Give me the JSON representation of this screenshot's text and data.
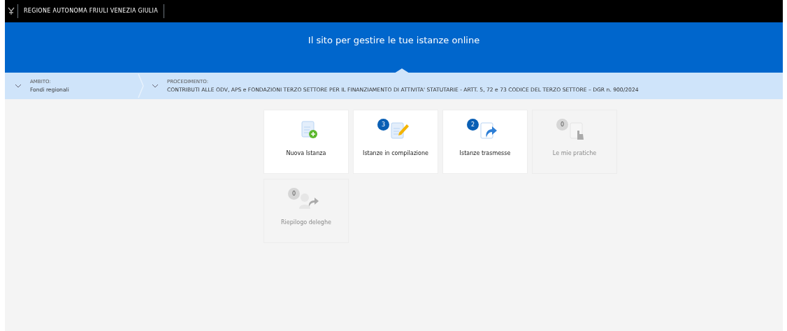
{
  "header": {
    "region_name": "REGIONE AUTONOMA FRIULI VENEZIA GIULIA"
  },
  "hero": {
    "title": "Il sito per gestire le tue istanze online"
  },
  "selectors": [
    {
      "label": "AMBITO:",
      "value": "Fondi regionali"
    },
    {
      "label": "PROCEDIMENTO:",
      "value": "CONTRIBUTI ALLE ODV, APS e FONDAZIONI TERZO SETTORE PER IL FINANZIAMENTO DI ATTIVITA' STATUTARIE - ARTT. 5, 72 e 73 CODICE DEL TERZO SETTORE – DGR n. 900/2024"
    }
  ],
  "tiles": [
    {
      "label": "Nuova Istanza",
      "kind": "new",
      "disabled": false
    },
    {
      "label": "Istanze in compilazione",
      "kind": "edit",
      "count": "3",
      "disabled": false
    },
    {
      "label": "Istanze trasmesse",
      "kind": "sent",
      "count": "2",
      "disabled": false
    },
    {
      "label": "Le mie pratiche",
      "kind": "hand",
      "count": "0",
      "disabled": true
    },
    {
      "label": "Riepilogo deleghe",
      "kind": "delegate",
      "count": "0",
      "disabled": true
    }
  ]
}
